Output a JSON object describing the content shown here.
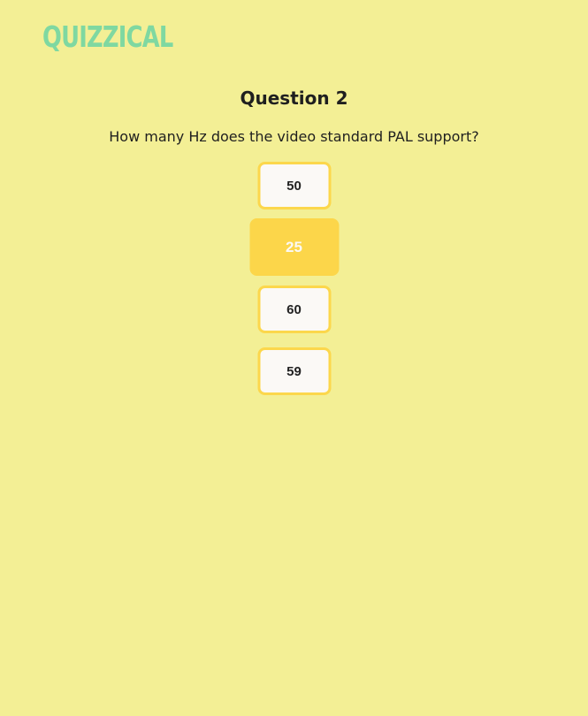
{
  "app": {
    "logo_text": "QUIZZICAL"
  },
  "question": {
    "title": "Question 2",
    "text": "How many Hz does the video standard PAL support?"
  },
  "answers": [
    {
      "label": "50",
      "selected": false
    },
    {
      "label": "25",
      "selected": true
    },
    {
      "label": "60",
      "selected": false
    },
    {
      "label": "59",
      "selected": false
    }
  ],
  "colors": {
    "background": "#f3ef95",
    "logo": "#7fd8a1",
    "answer_border": "#fcd74c",
    "answer_selected": "#fcd64a",
    "answer_bg": "#fbf9f6"
  }
}
